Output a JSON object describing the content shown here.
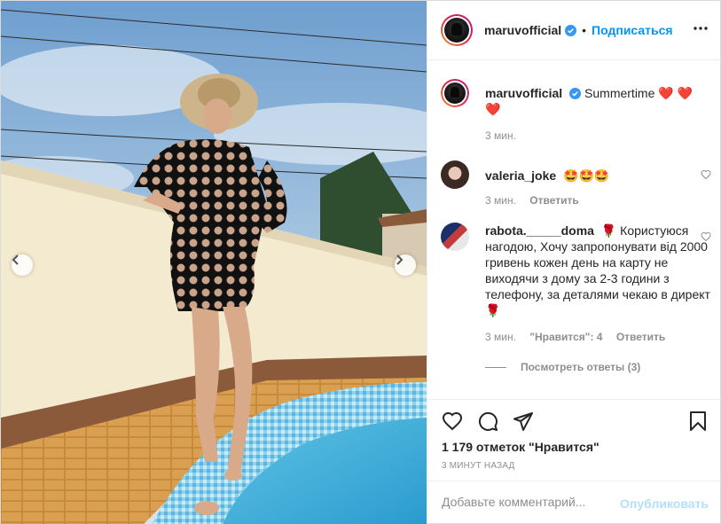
{
  "post": {
    "author": "maruvofficial",
    "follow_label": "Подписаться",
    "separator": "•",
    "verified_icon": "verified-badge-icon",
    "more_icon": "more-options-icon"
  },
  "caption": {
    "author": "maruvofficial",
    "text": "Summertime",
    "emoji": "❤️ ❤️ ❤️",
    "time": "3 мин."
  },
  "comments": [
    {
      "author": "valeria_joke",
      "text": "🤩🤩🤩",
      "time": "3 мин.",
      "reply_label": "Ответить"
    },
    {
      "author": "rabota._____doma",
      "text": "🌹 Користуюся нагодою, Хочу запропонувати від 2000 гривень кожен день на карту не виходячи з дому за 2-3 години з телефону, за деталями чекаю в директ 🌹",
      "time": "3 мин.",
      "likes": "\"Нравится\": 4",
      "reply_label": "Ответить",
      "view_replies": "Посмотреть ответы (3)"
    }
  ],
  "actions": {
    "like_icon": "heart-icon",
    "comment_icon": "comment-icon",
    "share_icon": "share-icon",
    "save_icon": "bookmark-icon"
  },
  "likes_count": "1 179 отметок \"Нравится\"",
  "time_ago": "3 МИНУТ НАЗАД",
  "add_comment": {
    "placeholder": "Добавьте комментарий...",
    "post_label": "Опубликовать"
  },
  "colors": {
    "accent": "#0095f6",
    "post_disabled": "#b2dffc",
    "muted": "#8e8e8e",
    "text": "#262626"
  }
}
